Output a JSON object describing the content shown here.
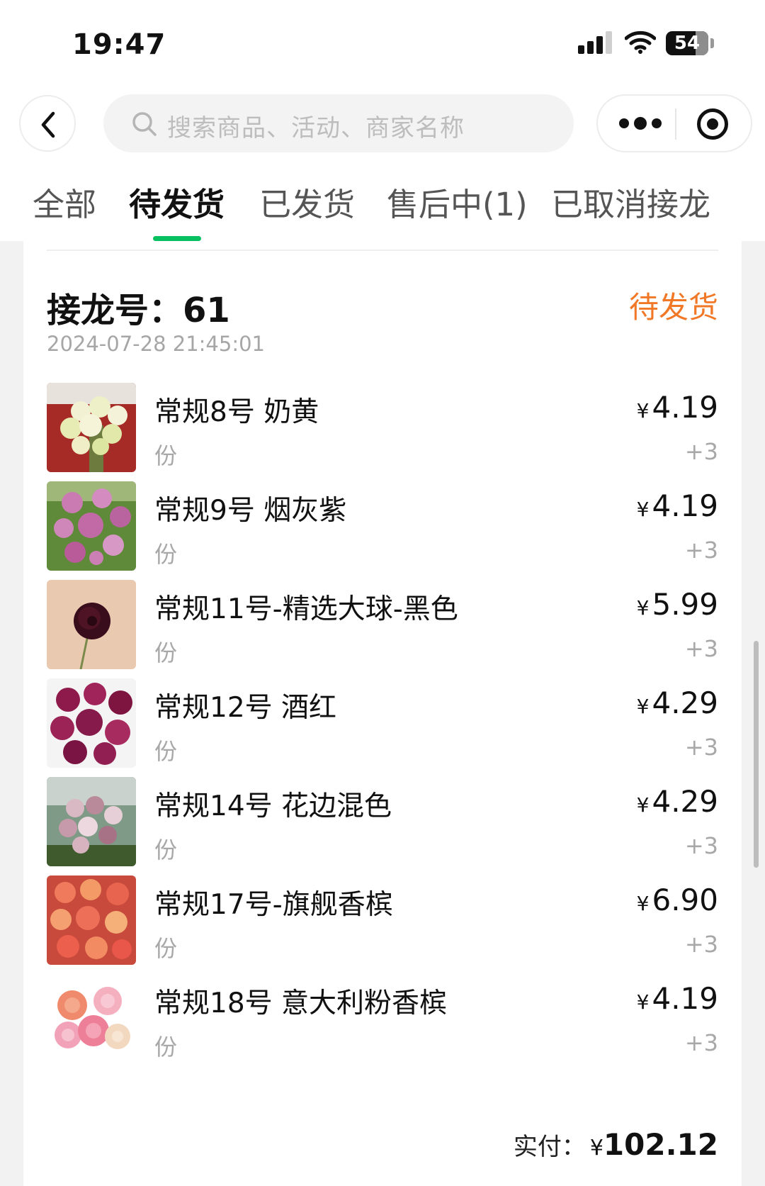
{
  "status_bar": {
    "time": "19:47",
    "battery": "54"
  },
  "header": {
    "search_placeholder": "搜索商品、活动、商家名称",
    "icons": [
      "back-icon",
      "search-icon",
      "more-icon",
      "target-icon",
      "signal-icon",
      "wifi-icon",
      "battery-icon"
    ]
  },
  "tabs": [
    {
      "label": "全部"
    },
    {
      "label": "待发货",
      "active": true
    },
    {
      "label": "已发货"
    },
    {
      "label": "售后中(1)"
    },
    {
      "label": "已取消接龙"
    }
  ],
  "order": {
    "label": "接龙号：",
    "number": "61",
    "status": "待发货",
    "time": "2024-07-28 21:45:01",
    "currency": "¥",
    "items": [
      {
        "name": "常规8号 奶黄",
        "unit": "份",
        "price": "4.19",
        "qty": "+3"
      },
      {
        "name": "常规9号 烟灰紫",
        "unit": "份",
        "price": "4.19",
        "qty": "+3"
      },
      {
        "name": "常规11号-精选大球-黑色",
        "unit": "份",
        "price": "5.99",
        "qty": "+3"
      },
      {
        "name": "常规12号 酒红",
        "unit": "份",
        "price": "4.29",
        "qty": "+3"
      },
      {
        "name": "常规14号 花边混色",
        "unit": "份",
        "price": "4.29",
        "qty": "+3"
      },
      {
        "name": "常规17号-旗舰香槟",
        "unit": "份",
        "price": "6.90",
        "qty": "+3"
      },
      {
        "name": "常规18号 意大利粉香槟",
        "unit": "份",
        "price": "4.19",
        "qty": "+3"
      }
    ],
    "paid_label": "实付：",
    "paid_amount": "102.12"
  },
  "colors": {
    "accent_green": "#07c160",
    "status_orange": "#f07826"
  }
}
